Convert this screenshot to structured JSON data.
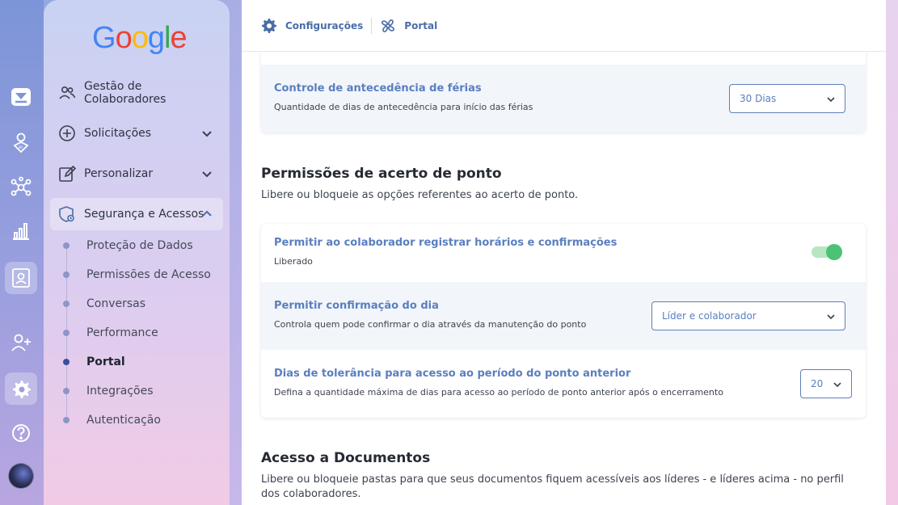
{
  "brand": {
    "logo_letters": [
      "G",
      "o",
      "o",
      "g",
      "l",
      "e"
    ],
    "logo_colors": [
      "#4285F4",
      "#EA4335",
      "#FBBC05",
      "#4285F4",
      "#34A853",
      "#EA4335"
    ]
  },
  "rail": {
    "icons": [
      "inbox-icon",
      "ai-user-icon",
      "network-icon",
      "chart-icon",
      "profile-card-icon",
      "add-user-icon",
      "settings-icon",
      "help-icon"
    ]
  },
  "sidebar": {
    "items": [
      {
        "label": "Gestão de Colaboradores",
        "icon": "users-icon"
      },
      {
        "label": "Solicitações",
        "icon": "plus-circle-icon"
      },
      {
        "label": "Personalizar",
        "icon": "edit-icon"
      },
      {
        "label": "Segurança e Acessos",
        "icon": "shield-icon"
      }
    ],
    "subitems": [
      "Proteção de Dados",
      "Permissões de Acesso",
      "Conversas",
      "Performance",
      "Portal",
      "Integrações",
      "Autenticação"
    ],
    "active_subitem": "Portal"
  },
  "breadcrumb": {
    "settings": "Configurações",
    "portal": "Portal"
  },
  "vacation_card": {
    "title": "Controle de antecedência de férias",
    "desc": "Quantidade de dias de antecedência para início das férias",
    "select_value": "30 Dias"
  },
  "punch_section": {
    "title": "Permissões de acerto de ponto",
    "desc": "Libere ou bloqueie as opções referentes ao acerto de ponto.",
    "rows": [
      {
        "title": "Permitir ao colaborador registrar horários e confirmações",
        "desc": "Liberado",
        "toggle_on": true
      },
      {
        "title": "Permitir confirmação do dia",
        "desc": "Controla quem pode confirmar o dia através da manutenção do ponto",
        "select_value": "Líder e colaborador"
      },
      {
        "title": "Dias de tolerância para acesso ao período do ponto anterior",
        "desc": "Defina a quantidade máxima de dias para acesso ao período de ponto anterior após o encerramento",
        "select_value": "20"
      }
    ]
  },
  "docs_section": {
    "title": "Acesso a Documentos",
    "desc": "Libere ou bloqueie pastas para que seus documentos fiquem acessíveis aos líderes - e líderes acima - no perfil dos colaboradores."
  },
  "colors": {
    "accent": "#5a7fbf",
    "toggle_on": "#4cc373"
  }
}
